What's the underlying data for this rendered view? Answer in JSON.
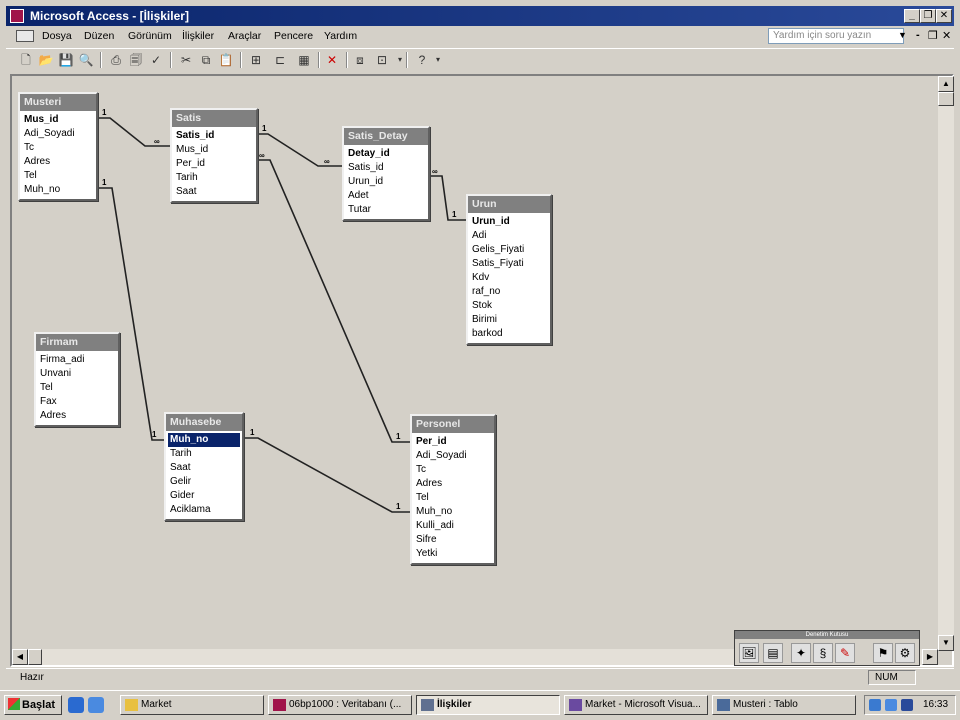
{
  "window": {
    "title": "Microsoft Access - [İlişkiler]",
    "controls": [
      "_",
      "❐",
      "✕"
    ]
  },
  "menu": {
    "items": [
      "Dosya",
      "Düzen",
      "Görünüm",
      "İlişkiler",
      "Araçlar",
      "Pencere",
      "Yardım"
    ],
    "help_placeholder": "Yardım için soru yazın",
    "doc_controls": [
      "-",
      "❐",
      "✕"
    ]
  },
  "relationships": {
    "tables": [
      {
        "name": "Musteri",
        "fields": [
          "Mus_id",
          "Adi_Soyadi",
          "Tc",
          "Adres",
          "Tel",
          "Muh_no"
        ],
        "key": 0
      },
      {
        "name": "Satis",
        "fields": [
          "Satis_id",
          "Mus_id",
          "Per_id",
          "Tarih",
          "Saat"
        ],
        "key": 0
      },
      {
        "name": "Satis_Detay",
        "fields": [
          "Detay_id",
          "Satis_id",
          "Urun_id",
          "Adet",
          "Tutar"
        ],
        "key": 0
      },
      {
        "name": "Urun",
        "fields": [
          "Urun_id",
          "Adi",
          "Gelis_Fiyati",
          "Satis_Fiyati",
          "Kdv",
          "raf_no",
          "Stok",
          "Birimi",
          "barkod"
        ],
        "key": 0
      },
      {
        "name": "Firmam",
        "fields": [
          "Firma_adi",
          "Unvani",
          "Tel",
          "Fax",
          "Adres"
        ],
        "key": -1
      },
      {
        "name": "Muhasebe",
        "fields": [
          "Muh_no",
          "Tarih",
          "Saat",
          "Gelir",
          "Gider",
          "Aciklama"
        ],
        "key": 0
      },
      {
        "name": "Personel",
        "fields": [
          "Per_id",
          "Adi_Soyadi",
          "Tc",
          "Adres",
          "Tel",
          "Muh_no",
          "Kulli_adi",
          "Sifre",
          "Yetki"
        ],
        "key": 0
      }
    ],
    "cardinality": {
      "one": "1",
      "many": "∞"
    }
  },
  "floating_toolbar": {
    "title": "Denetim Kutusu"
  },
  "status": {
    "left": "Hazır",
    "num": "NUM"
  },
  "taskbar": {
    "start": "Başlat",
    "tasks": [
      {
        "label": "Market",
        "active": false
      },
      {
        "label": "06bp1000 : Veritabanı (...",
        "active": false
      },
      {
        "label": "İlişkiler",
        "active": true
      },
      {
        "label": "Market - Microsoft Visua...",
        "active": false
      },
      {
        "label": "Musteri : Tablo",
        "active": false
      }
    ],
    "clock": "16:33"
  }
}
